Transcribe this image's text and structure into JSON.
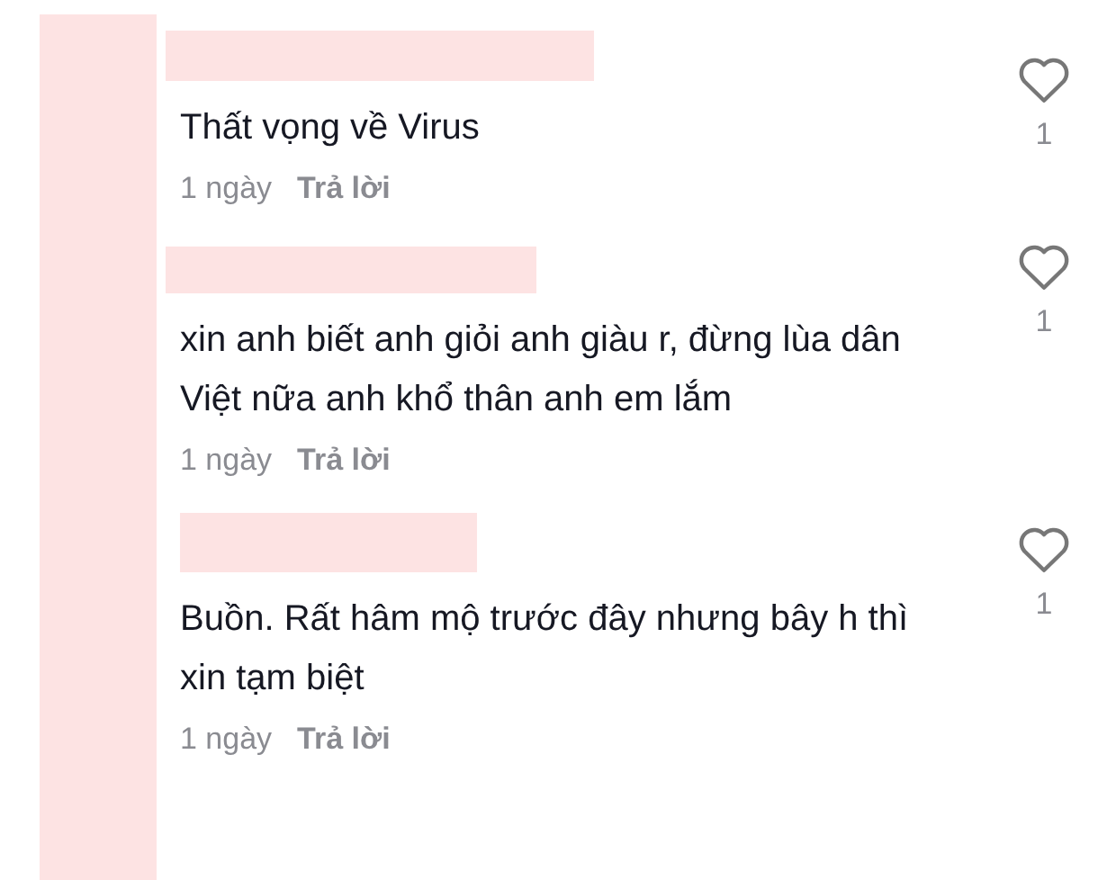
{
  "comments": [
    {
      "text": "Thất vọng về Virus",
      "time": "1 ngày",
      "reply": "Trả lời",
      "likes": "1"
    },
    {
      "text": "xin anh biết anh giỏi anh giàu r, đừng lùa dân Việt nữa anh khổ thân anh em lắm",
      "time": "1 ngày",
      "reply": "Trả lời",
      "likes": "1"
    },
    {
      "text": "Buồn. Rất hâm mộ trước đây nhưng bây h thì xin tạm biệt",
      "time": "1 ngày",
      "reply": "Trả lời",
      "likes": "1"
    }
  ]
}
